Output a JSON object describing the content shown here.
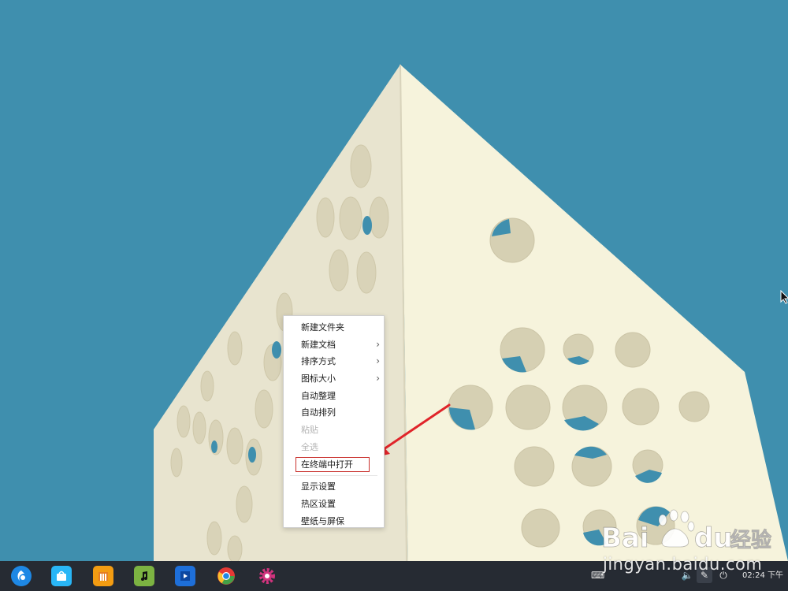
{
  "colors": {
    "sky": "#3f8fae",
    "building_face_left": "#e8e4cf",
    "building_face_right": "#f6f3dc",
    "taskbar": "#262b33",
    "highlight_border": "#c9302c",
    "arrow": "#e0242a"
  },
  "context_menu": {
    "items": [
      {
        "label": "新建文件夹",
        "submenu": false,
        "disabled": false
      },
      {
        "label": "新建文档",
        "submenu": true,
        "disabled": false
      },
      {
        "label": "排序方式",
        "submenu": true,
        "disabled": false
      },
      {
        "label": "图标大小",
        "submenu": true,
        "disabled": false
      },
      {
        "label": "自动整理",
        "submenu": false,
        "disabled": false
      },
      {
        "label": "自动排列",
        "submenu": false,
        "disabled": false
      },
      {
        "label": "粘贴",
        "submenu": false,
        "disabled": true
      },
      {
        "label": "全选",
        "submenu": false,
        "disabled": true
      },
      {
        "label": "在终端中打开",
        "submenu": false,
        "disabled": false,
        "highlighted": true
      },
      {
        "label": "显示设置",
        "submenu": false,
        "disabled": false
      },
      {
        "label": "热区设置",
        "submenu": false,
        "disabled": false
      },
      {
        "label": "壁纸与屏保",
        "submenu": false,
        "disabled": false
      }
    ],
    "submenu_arrow": "›"
  },
  "taskbar": {
    "dock": [
      {
        "name": "launcher-icon",
        "color": "#1e88e5"
      },
      {
        "name": "app-store-icon",
        "color": "#29b6f6"
      },
      {
        "name": "file-manager-icon",
        "color": "#f39c12"
      },
      {
        "name": "music-icon",
        "color": "#7cb342"
      },
      {
        "name": "video-icon",
        "color": "#1e6fd9"
      },
      {
        "name": "chrome-icon",
        "color": "#e53935"
      },
      {
        "name": "settings-icon",
        "color": "#d0337d"
      }
    ],
    "tray": {
      "keyboard_icon": "⌨",
      "volume_icon": "🔈",
      "pen_icon": "✎",
      "power_icon": "⏻"
    },
    "clock": "02:24 下午"
  },
  "watermark": {
    "logo_text_left": "Bai",
    "logo_text_right": "du",
    "logo_cn": "经验",
    "url": "jingyan.baidu.com"
  }
}
